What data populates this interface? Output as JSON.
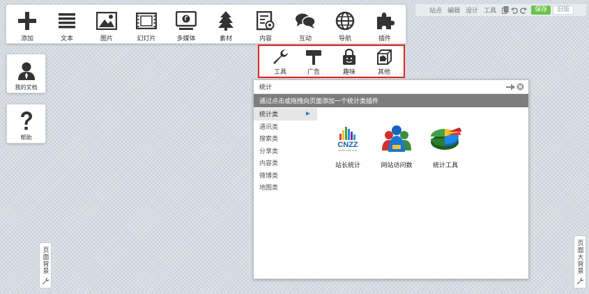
{
  "toolbar": {
    "items": [
      {
        "label": "添加",
        "icon": "plus-icon"
      },
      {
        "label": "文本",
        "icon": "text-lines-icon"
      },
      {
        "label": "图片",
        "icon": "picture-icon"
      },
      {
        "label": "幻灯片",
        "icon": "film-strip-icon"
      },
      {
        "label": "多媒体",
        "icon": "media-player-icon"
      },
      {
        "label": "素材",
        "icon": "tree-icon"
      },
      {
        "label": "内容",
        "icon": "content-document-icon"
      },
      {
        "label": "互动",
        "icon": "chat-bubbles-icon"
      },
      {
        "label": "导航",
        "icon": "globe-icon"
      },
      {
        "label": "插件",
        "icon": "puzzle-icon"
      }
    ]
  },
  "subtoolbar": {
    "items": [
      {
        "label": "工具",
        "icon": "wrench-icon"
      },
      {
        "label": "广告",
        "icon": "billboard-icon"
      },
      {
        "label": "趣味",
        "icon": "smile-bag-icon"
      },
      {
        "label": "其他",
        "icon": "puzzle-box-icon"
      }
    ]
  },
  "topbar": {
    "links": [
      "站点",
      "编辑",
      "设计",
      "工具"
    ],
    "save_label": "保存",
    "old_label": "旧版"
  },
  "side": {
    "my_docs": "我的文档",
    "help": "帮助",
    "page_bg": "页面背景",
    "page_big_bg": "页面大背景"
  },
  "panel": {
    "title": "统计",
    "description": "通过点击或拖拽向页面添加一个统计类插件",
    "categories": [
      "统计类",
      "通讯类",
      "搜索类",
      "分享类",
      "内容类",
      "微博类",
      "地图类"
    ],
    "active_category": "统计类",
    "plugins": [
      {
        "label": "站长统计",
        "logo_text": "CNZZ",
        "logo_sub": "www.cnzz.com"
      },
      {
        "label": "网站访问数"
      },
      {
        "label": "统计工具"
      }
    ]
  },
  "colors": {
    "highlight_border": "#e0241d",
    "save_green": "#6cc24a",
    "desc_bar": "#7d7d7d",
    "icon_dark": "#333333"
  }
}
